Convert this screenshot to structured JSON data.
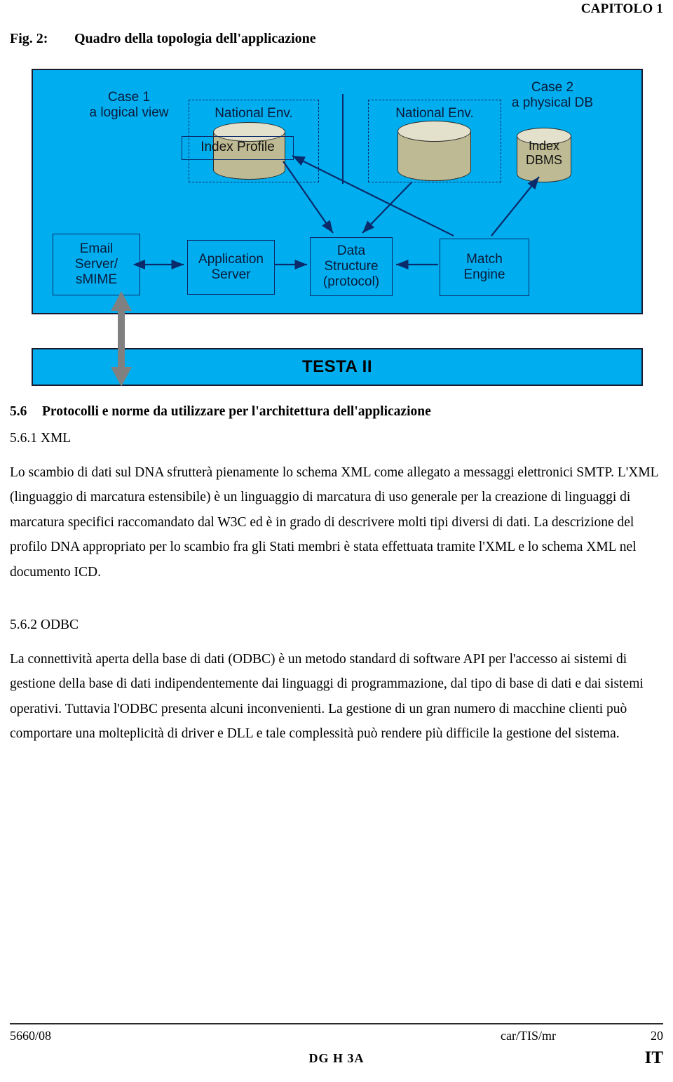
{
  "header": {
    "chapter": "CAPITOLO 1"
  },
  "figure": {
    "label": "Fig. 2:",
    "caption": "Quadro della topologia dell'applicazione",
    "diagram": {
      "case1_title": "Case 1\na logical view",
      "case2_title": "Case 2\na physical DB",
      "natenv_left_label": "National Env.",
      "natenv_right_label": "National Env.",
      "index_profile_label": "Index Profile",
      "index_dbms_label": "Index\nDBMS",
      "box_email": "Email\nServer/\nsMIME",
      "box_app": "Application\nServer",
      "box_data": "Data\nStructure\n(protocol)",
      "box_match": "Match\nEngine",
      "testa_label": "TESTA II",
      "colors": {
        "panel_blue": "#00AEEF",
        "panel_border": "#1a1a2e",
        "cylinder_body": "#BEBA93",
        "cylinder_top": "#E3E1CC",
        "box_border": "#0a2a6a",
        "gray_arrow": "#808080"
      }
    }
  },
  "body": {
    "section_5_6": {
      "number": "5.6",
      "title": "Protocolli e norme da utilizzare per l'architettura dell'applicazione"
    },
    "section_5_6_1": {
      "heading": "5.6.1 XML",
      "paragraph": "Lo scambio di dati sul DNA sfrutterà pienamente lo schema XML come allegato a messaggi elettronici SMTP. L'XML (linguaggio di marcatura estensibile) è un linguaggio di marcatura di uso generale per la creazione di linguaggi di marcatura specifici raccomandato dal W3C ed è in grado di descrivere molti tipi diversi di dati. La descrizione del profilo DNA appropriato per lo scambio fra gli Stati membri è stata effettuata tramite l'XML e lo schema XML nel documento ICD."
    },
    "section_5_6_2": {
      "heading": "5.6.2 ODBC",
      "paragraph": "La connettività aperta della base di dati (ODBC) è un metodo standard di software API per l'accesso ai sistemi di gestione della base di dati indipendentemente dai linguaggi di programmazione, dal tipo di base di dati e dai sistemi operativi. Tuttavia l'ODBC presenta alcuni inconvenienti. La gestione di un gran numero di macchine clienti può comportare una molteplicità di driver e DLL e tale complessità può rendere più difficile la gestione del sistema."
    }
  },
  "footer": {
    "doc_ref": "5660/08",
    "ref_code": "car/TIS/mr",
    "page_no": "20",
    "dg_code": "DG H 3A",
    "lang_code": "IT"
  }
}
